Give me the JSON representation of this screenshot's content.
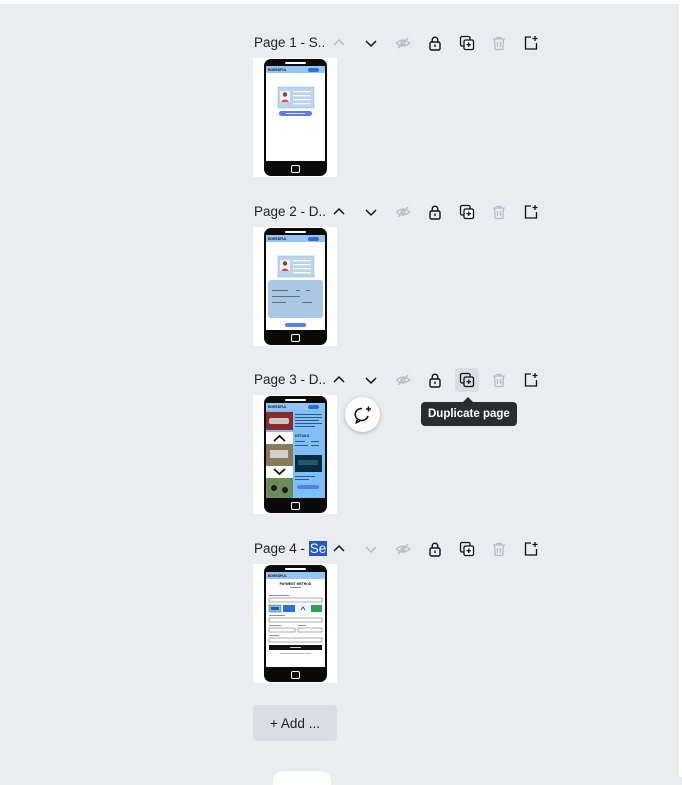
{
  "pages": [
    {
      "title": "Page 1 - S..",
      "highlight": "",
      "thumbnail": "login-screen"
    },
    {
      "title": "Page 2 - D..",
      "highlight": "",
      "thumbnail": "details-screen"
    },
    {
      "title": "Page 3 - D..",
      "highlight": "",
      "thumbnail": "gallery-screen"
    },
    {
      "title": "Page 4 - ",
      "highlight": "Se",
      "thumbnail": "payment-screen"
    }
  ],
  "controls": {
    "move_up": "chevron-up-icon",
    "move_down": "chevron-down-icon",
    "hide": "eye-off-icon",
    "lock": "lock-icon",
    "duplicate": "duplicate-icon",
    "delete": "trash-icon",
    "add": "add-page-icon"
  },
  "tooltip": "Duplicate page",
  "add_page_label": "+ Add ...",
  "thumb_texts": {
    "logo": "BOREDFUL",
    "details_heading": "DETAILS",
    "payment_heading": "PAYMENT METHOD"
  },
  "colors": {
    "background": "#ebecf0",
    "tooltip_bg": "#2b2c2f",
    "selection": "#1e59c8",
    "icon_active": "#0e1318",
    "icon_disabled": "#b7bbc2",
    "phone": "#0a0a0a",
    "screen_accent": "#93c5f4"
  }
}
